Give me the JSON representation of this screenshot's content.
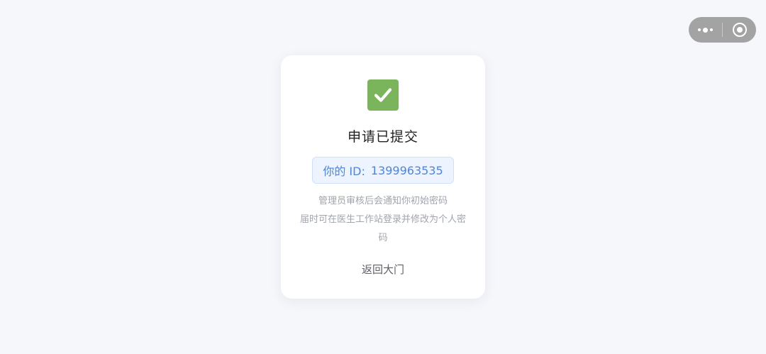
{
  "capsule": {
    "more_icon": "more-dots-icon",
    "close_icon": "target-circle-icon"
  },
  "card": {
    "status_icon": "check-mark-icon",
    "title": "申请已提交",
    "id_label": "你的 ID:",
    "id_value": "1399963535",
    "desc_line1": "管理员审核后会通知你初始密码",
    "desc_line2": "届时可在医生工作站登录并修改为个人密码",
    "back_label": "返回大门"
  },
  "colors": {
    "background": "#f6f7fb",
    "accent_blue": "#4a86e8",
    "success_green": "#7ab55c"
  }
}
